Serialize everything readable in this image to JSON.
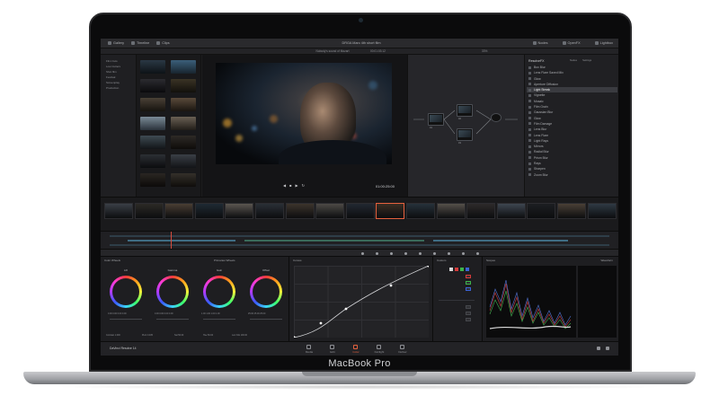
{
  "device": {
    "label": "MacBook Pro"
  },
  "app": {
    "topbar": {
      "left_items": [
        "Gallery",
        "Timeline",
        "Clips"
      ],
      "title": "DRGA Marc 4th short film",
      "right_items": [
        "Nodes",
        "OpenFX",
        "Lightbox"
      ]
    },
    "toolbar": {
      "clip_name": "Nobody's sound of Mozart",
      "timecode": "00:01:03:12",
      "zoom": "33%"
    },
    "bins": [
      "Film Cuts",
      "Low Cutters",
      "Shot film",
      "Festival",
      "Screenplay",
      "Production"
    ],
    "viewer": {
      "timecode": "01:00:25:00"
    },
    "effects": {
      "title": "ResolveFX",
      "tabs": [
        "Nodes",
        "Settings"
      ],
      "items": [
        "Box Blur",
        "Lens Flare Saved Mix",
        "Glow",
        "Aperture Diffusion",
        "Light Streak",
        "Vignette",
        "Mosaic",
        "Film Grain",
        "Gaussian Blur",
        "Glow",
        "Film Damage",
        "Lens Blur",
        "Lens Flare",
        "Light Rays",
        "Mirrors",
        "Radial Blur",
        "Prism Blur",
        "Rays",
        "Sharpen",
        "Zoom Blur"
      ],
      "selected_index": 4
    },
    "wheels": {
      "title": "Color Wheels",
      "mode": "Primaries Wheels",
      "labels": [
        "Lift",
        "Gamma",
        "Gain",
        "Offset"
      ],
      "values": [
        "0.00  0.00  0.00  0.00",
        "0.00  0.00  0.00  0.00",
        "1.00  1.00  1.00  1.00",
        "25.00  25.00  25.00"
      ],
      "footer": [
        "Contrast 1.000",
        "Pivot 0.435",
        "Sat 50.00",
        "Hue 50.00",
        "Lum Mix 100.00"
      ]
    },
    "curves": {
      "title": "Curves",
      "custom": "Custom"
    },
    "scopes": {
      "title": "Scopes",
      "mode": "Waveform"
    },
    "pages": {
      "project": "DaVinci Resolve 14",
      "tabs": [
        "Media",
        "Edit",
        "Color",
        "Fairlight",
        "Deliver"
      ],
      "active_index": 2
    }
  },
  "colors": {
    "accent": "#e6613e",
    "playhead": "#d84b3c",
    "panel": "#1e1e21"
  }
}
